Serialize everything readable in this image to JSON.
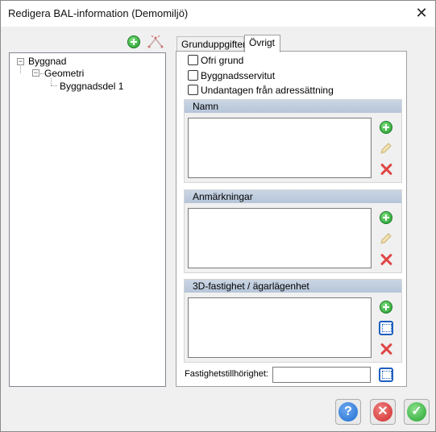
{
  "window": {
    "title": "Redigera BAL-information (Demomiljö)",
    "close_glyph": "✕"
  },
  "tree": {
    "nodes": [
      {
        "label": "Byggnad",
        "expander": "−"
      },
      {
        "label": "Geometri",
        "expander": "−"
      },
      {
        "label": "Byggnadsdel 1"
      }
    ]
  },
  "tabs": [
    {
      "label": "Grunduppgifter",
      "active": false
    },
    {
      "label": "Övrigt",
      "active": true
    }
  ],
  "checkboxes": [
    {
      "label": "Ofri grund",
      "checked": false
    },
    {
      "label": "Byggnadsservitut",
      "checked": false
    },
    {
      "label": "Undantagen från adressättning",
      "checked": false
    }
  ],
  "groups": {
    "namn": {
      "title": "Namn"
    },
    "anmarkningar": {
      "title": "Anmärkningar"
    },
    "fastighet3d": {
      "title": "3D-fastighet / ägarlägenhet"
    }
  },
  "fastighetstillhorighet": {
    "label": "Fastighetstillhörighet:",
    "value": ""
  },
  "footer": {
    "help_glyph": "?",
    "cancel_glyph": "✕",
    "ok_glyph": "✓"
  },
  "colors": {
    "add_green": "#1e9a2b",
    "delete_red": "#e04545",
    "help_blue": "#1f6fd1",
    "header_blue": "#b5c4d8"
  }
}
